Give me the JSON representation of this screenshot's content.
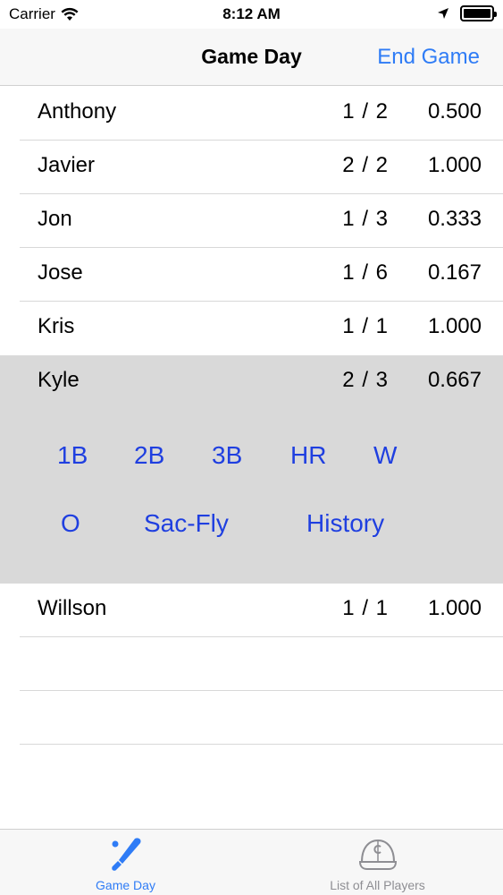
{
  "status": {
    "carrier": "Carrier",
    "time": "8:12 AM"
  },
  "nav": {
    "title": "Game Day",
    "action": "End Game"
  },
  "players": [
    {
      "name": "Anthony",
      "ratio": "1 / 2",
      "avg": "0.500"
    },
    {
      "name": "Javier",
      "ratio": "2 / 2",
      "avg": "1.000"
    },
    {
      "name": "Jon",
      "ratio": "1 / 3",
      "avg": "0.333"
    },
    {
      "name": "Jose",
      "ratio": "1 / 6",
      "avg": "0.167"
    },
    {
      "name": "Kris",
      "ratio": "1 / 1",
      "avg": "1.000"
    },
    {
      "name": "Kyle",
      "ratio": "2 / 3",
      "avg": "0.667"
    },
    {
      "name": "Willson",
      "ratio": "1 / 1",
      "avg": "1.000"
    }
  ],
  "actions": {
    "single": "1B",
    "double": "2B",
    "triple": "3B",
    "homerun": "HR",
    "walk": "W",
    "out": "O",
    "sacfly": "Sac-Fly",
    "history": "History"
  },
  "tabs": [
    {
      "label": "Game Day",
      "icon": "baseball-bat-icon",
      "active": true
    },
    {
      "label": "List of All Players",
      "icon": "baseball-cap-icon",
      "active": false
    }
  ],
  "colors": {
    "accent": "#2f7cf6",
    "action_text": "#1f3fe0",
    "expanded_bg": "#d9d9d9"
  }
}
